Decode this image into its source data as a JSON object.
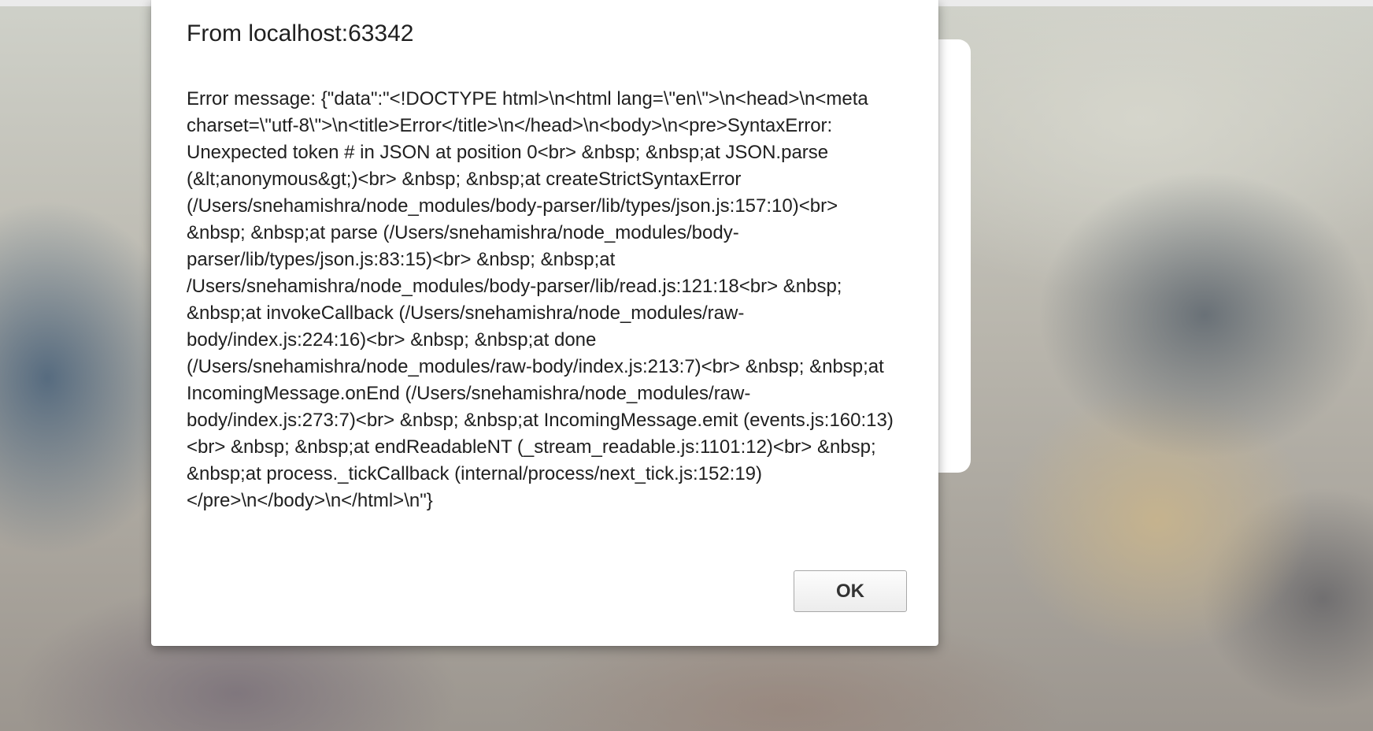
{
  "dialog": {
    "title": "From localhost:63342",
    "message": "Error message: {\"data\":\"<!DOCTYPE html>\\n<html lang=\\\"en\\\">\\n<head>\\n<meta charset=\\\"utf-8\\\">\\n<title>Error</title>\\n</head>\\n<body>\\n<pre>SyntaxError: Unexpected token # in JSON at position 0<br> &nbsp; &nbsp;at JSON.parse (&lt;anonymous&gt;)<br> &nbsp; &nbsp;at createStrictSyntaxError (/Users/snehamishra/node_modules/body-parser/lib/types/json.js:157:10)<br> &nbsp; &nbsp;at parse (/Users/snehamishra/node_modules/body-parser/lib/types/json.js:83:15)<br> &nbsp; &nbsp;at /Users/snehamishra/node_modules/body-parser/lib/read.js:121:18<br> &nbsp; &nbsp;at invokeCallback (/Users/snehamishra/node_modules/raw-body/index.js:224:16)<br> &nbsp; &nbsp;at done (/Users/snehamishra/node_modules/raw-body/index.js:213:7)<br> &nbsp; &nbsp;at IncomingMessage.onEnd (/Users/snehamishra/node_modules/raw-body/index.js:273:7)<br> &nbsp; &nbsp;at IncomingMessage.emit (events.js:160:13)<br> &nbsp; &nbsp;at endReadableNT (_stream_readable.js:1101:12)<br> &nbsp; &nbsp;at process._tickCallback (internal/process/next_tick.js:152:19)</pre>\\n</body>\\n</html>\\n\"}",
    "ok_label": "OK"
  }
}
